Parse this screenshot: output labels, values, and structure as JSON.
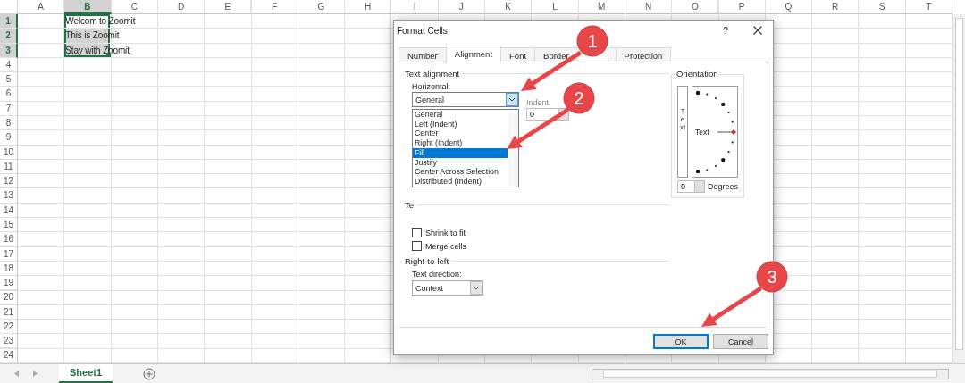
{
  "sheet": {
    "columns": [
      {
        "label": "A",
        "selected": false
      },
      {
        "label": "B",
        "selected": true
      },
      {
        "label": "C",
        "selected": false
      },
      {
        "label": "D",
        "selected": false
      },
      {
        "label": "E",
        "selected": false
      },
      {
        "label": "F",
        "selected": false
      },
      {
        "label": "G",
        "selected": false
      },
      {
        "label": "H",
        "selected": false
      },
      {
        "label": "I",
        "selected": false
      },
      {
        "label": "J",
        "selected": false
      },
      {
        "label": "K",
        "selected": false
      },
      {
        "label": "L",
        "selected": false
      },
      {
        "label": "M",
        "selected": false
      },
      {
        "label": "N",
        "selected": false
      },
      {
        "label": "O",
        "selected": false
      },
      {
        "label": "P",
        "selected": false
      },
      {
        "label": "Q",
        "selected": false
      },
      {
        "label": "R",
        "selected": false
      },
      {
        "label": "S",
        "selected": false
      },
      {
        "label": "T",
        "selected": false
      }
    ],
    "rows": [
      {
        "label": "1",
        "selected": true,
        "cell_b": {
          "text": "Welcom to Zoomit",
          "active": true
        }
      },
      {
        "label": "2",
        "selected": true,
        "cell_b": {
          "text": "This is Zoomit",
          "active": false
        }
      },
      {
        "label": "3",
        "selected": true,
        "cell_b": {
          "text": "Stay with Zoomit",
          "active": false
        }
      },
      {
        "label": "4",
        "selected": false
      },
      {
        "label": "5",
        "selected": false
      },
      {
        "label": "6",
        "selected": false
      },
      {
        "label": "7",
        "selected": false
      },
      {
        "label": "8",
        "selected": false
      },
      {
        "label": "9",
        "selected": false
      },
      {
        "label": "10",
        "selected": false
      },
      {
        "label": "11",
        "selected": false
      },
      {
        "label": "12",
        "selected": false
      },
      {
        "label": "13",
        "selected": false
      },
      {
        "label": "14",
        "selected": false
      },
      {
        "label": "15",
        "selected": false
      },
      {
        "label": "16",
        "selected": false
      },
      {
        "label": "17",
        "selected": false
      },
      {
        "label": "18",
        "selected": false
      },
      {
        "label": "19",
        "selected": false
      },
      {
        "label": "20",
        "selected": false
      },
      {
        "label": "21",
        "selected": false
      },
      {
        "label": "22",
        "selected": false
      },
      {
        "label": "23",
        "selected": false
      },
      {
        "label": "24",
        "selected": false
      }
    ]
  },
  "dialog": {
    "title": "Format Cells",
    "help": "?",
    "tabs": [
      {
        "label": "Number",
        "selected": false
      },
      {
        "label": "Alignment",
        "selected": true
      },
      {
        "label": "Font",
        "selected": false
      },
      {
        "label": "Border",
        "selected": false
      },
      {
        "selected": false
      },
      {
        "label": "Protection",
        "selected": false
      }
    ],
    "text_alignment": {
      "heading": "Text alignment",
      "horizontal_label": "Horizontal:",
      "horizontal_value": "General",
      "horizontal_options": [
        {
          "label": "General",
          "selected": false
        },
        {
          "label": "Left (Indent)",
          "selected": false
        },
        {
          "label": "Center",
          "selected": false
        },
        {
          "label": "Right (Indent)",
          "selected": false
        },
        {
          "label": "Fill",
          "selected": true
        },
        {
          "label": "Justify",
          "selected": false
        },
        {
          "label": "Center Across Selection",
          "selected": false
        },
        {
          "label": "Distributed (Indent)",
          "selected": false
        }
      ],
      "indent_label": "Indent:",
      "indent_value": "0"
    },
    "text_control": {
      "heading": "Te",
      "options": [
        {
          "label": "Shrink to fit",
          "checked": false
        },
        {
          "label": "Merge cells",
          "checked": false
        }
      ]
    },
    "right_to_left": {
      "heading": "Right-to-left",
      "direction_label": "Text direction:",
      "direction_value": "Context"
    },
    "orientation": {
      "heading": "Orientation",
      "vertical_text": "Text",
      "dial_text": "Text",
      "degrees_value": "0",
      "degrees_label": "Degrees"
    },
    "buttons": [
      {
        "label": "OK",
        "default": true
      },
      {
        "label": "Cancel",
        "default": false
      }
    ]
  },
  "sheet_tabs": [
    {
      "label": "Sheet1",
      "selected": true
    }
  ],
  "annotations": [
    "1",
    "2",
    "3"
  ]
}
